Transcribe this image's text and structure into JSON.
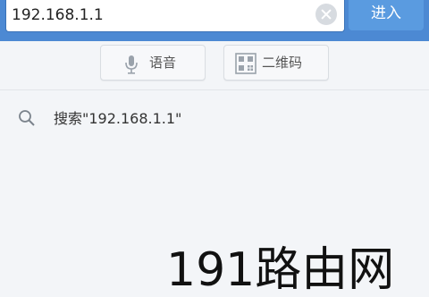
{
  "browser": {
    "url_value": "192.168.1.1",
    "go_label": "进入"
  },
  "toolbar": {
    "voice_label": "语音",
    "qr_label": "二维码"
  },
  "suggestions": [
    {
      "label": "搜索\"192.168.1.1\""
    }
  ],
  "overlay": {
    "text": "191路由网"
  },
  "colors": {
    "topbar": "#4c89d3",
    "go_button": "#5a9be0",
    "background": "#f3f5f8"
  },
  "icons": [
    "clear-icon",
    "microphone-icon",
    "qr-code-icon",
    "search-icon"
  ]
}
